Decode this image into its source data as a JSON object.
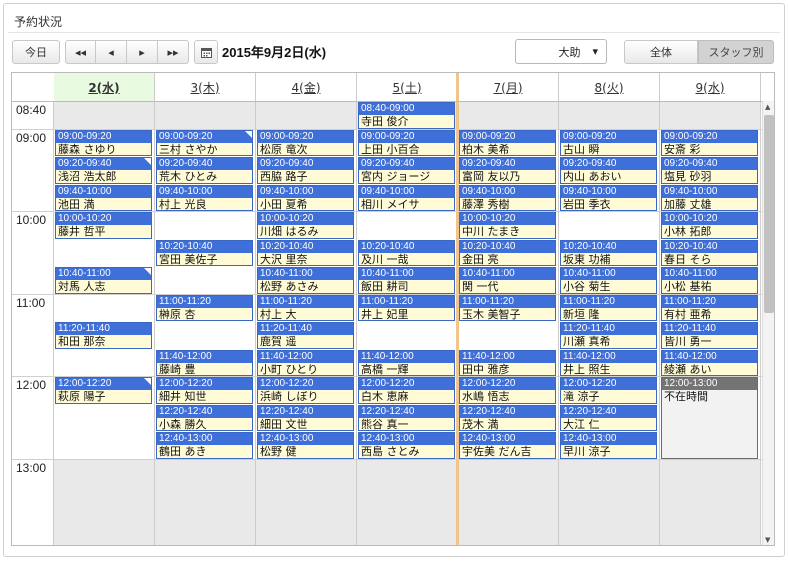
{
  "panel": {
    "title": "予約状況"
  },
  "toolbar": {
    "today_label": "今日",
    "prev_month": "◂◂",
    "prev": "◂",
    "next": "▸",
    "next_month": "▸▸",
    "calendar_icon": "calendar-icon",
    "date_title": "2015年9月2日(水)",
    "facility": {
      "selected": "大助",
      "caret": "▾"
    },
    "view_all": "全体",
    "view_staff": "スタッフ別",
    "active_view": "スタッフ別"
  },
  "colors": {
    "accent": "#3f6fd9",
    "appointment_bg": "#fffbd6",
    "today_bg": "#e8fbe0",
    "today_line": "#f0c48a",
    "blocked": "#747474"
  },
  "times": [
    "08:40",
    "09:00",
    "10:00",
    "11:00",
    "12:00",
    "13:00"
  ],
  "days": [
    {
      "label": "2(水)",
      "today": true,
      "bold": true,
      "appts": [
        {
          "time": "09:00-09:20",
          "name": "藤森 さゆり"
        },
        {
          "time": "09:20-09:40",
          "name": "浅沼 浩太郎",
          "flag": true
        },
        {
          "time": "09:40-10:00",
          "name": "池田 満"
        },
        {
          "time": "10:00-10:20",
          "name": "藤井 哲平"
        },
        {
          "time": "10:40-11:00",
          "name": "対馬 人志",
          "flag": true
        },
        {
          "time": "11:20-11:40",
          "name": "和田 那奈"
        },
        {
          "time": "12:00-12:20",
          "name": "萩原 陽子",
          "flag": true
        }
      ]
    },
    {
      "label": "3(木)",
      "appts": [
        {
          "time": "09:00-09:20",
          "name": "三村 さやか",
          "flag": true
        },
        {
          "time": "09:20-09:40",
          "name": "荒木 ひとみ"
        },
        {
          "time": "09:40-10:00",
          "name": "村上 光良"
        },
        {
          "time": "10:20-10:40",
          "name": "宮田 美佐子"
        },
        {
          "time": "11:00-11:20",
          "name": "榊原 杏"
        },
        {
          "time": "11:40-12:00",
          "name": "藤崎 豊"
        },
        {
          "time": "12:00-12:20",
          "name": "細井 知世"
        },
        {
          "time": "12:20-12:40",
          "name": "小森 勝久"
        },
        {
          "time": "12:40-13:00",
          "name": "鶴田 あき"
        }
      ]
    },
    {
      "label": "4(金)",
      "appts": [
        {
          "time": "09:00-09:20",
          "name": "松原 竜次"
        },
        {
          "time": "09:20-09:40",
          "name": "西脇 路子"
        },
        {
          "time": "09:40-10:00",
          "name": "小田 夏希"
        },
        {
          "time": "10:00-10:20",
          "name": "川畑 はるみ"
        },
        {
          "time": "10:20-10:40",
          "name": "大沢 里奈"
        },
        {
          "time": "10:40-11:00",
          "name": "松野 あさみ"
        },
        {
          "time": "11:00-11:20",
          "name": "村上 大"
        },
        {
          "time": "11:20-11:40",
          "name": "鹿賀 遥"
        },
        {
          "time": "11:40-12:00",
          "name": "小町 ひとり"
        },
        {
          "time": "12:00-12:20",
          "name": "浜崎 しぼり"
        },
        {
          "time": "12:20-12:40",
          "name": "細田 文世"
        },
        {
          "time": "12:40-13:00",
          "name": "松野 健"
        }
      ]
    },
    {
      "label": "5(土)",
      "appts": [
        {
          "time": "08:40-09:00",
          "name": "寺田 俊介"
        },
        {
          "time": "09:00-09:20",
          "name": "上田 小百合"
        },
        {
          "time": "09:20-09:40",
          "name": "宮内 ジョージ"
        },
        {
          "time": "09:40-10:00",
          "name": "相川 メイサ"
        },
        {
          "time": "10:20-10:40",
          "name": "及川 一哉"
        },
        {
          "time": "10:40-11:00",
          "name": "飯田 耕司"
        },
        {
          "time": "11:00-11:20",
          "name": "井上 妃里"
        },
        {
          "time": "11:40-12:00",
          "name": "高橋 一輝"
        },
        {
          "time": "12:00-12:20",
          "name": "白木 恵麻"
        },
        {
          "time": "12:20-12:40",
          "name": "熊谷 真一"
        },
        {
          "time": "12:40-13:00",
          "name": "西島 さとみ"
        }
      ]
    },
    {
      "label": "7(月)",
      "appts": [
        {
          "time": "09:00-09:20",
          "name": "柏木 美希"
        },
        {
          "time": "09:20-09:40",
          "name": "富岡 友以乃"
        },
        {
          "time": "09:40-10:00",
          "name": "藤澤 秀樹"
        },
        {
          "time": "10:00-10:20",
          "name": "中川 たまき"
        },
        {
          "time": "10:20-10:40",
          "name": "金田 亮"
        },
        {
          "time": "10:40-11:00",
          "name": "関 一代"
        },
        {
          "time": "11:00-11:20",
          "name": "玉木 美智子"
        },
        {
          "time": "11:40-12:00",
          "name": "田中 雅彦"
        },
        {
          "time": "12:00-12:20",
          "name": "水嶋 悟志"
        },
        {
          "time": "12:20-12:40",
          "name": "茂木 満"
        },
        {
          "time": "12:40-13:00",
          "name": "宇佐美 だん吉"
        }
      ]
    },
    {
      "label": "8(火)",
      "appts": [
        {
          "time": "09:00-09:20",
          "name": "古山 瞬"
        },
        {
          "time": "09:20-09:40",
          "name": "内山 あおい"
        },
        {
          "time": "09:40-10:00",
          "name": "岩田 季衣"
        },
        {
          "time": "10:20-10:40",
          "name": "坂東 功補"
        },
        {
          "time": "10:40-11:00",
          "name": "小谷 菊生"
        },
        {
          "time": "11:00-11:20",
          "name": "新垣 隆"
        },
        {
          "time": "11:20-11:40",
          "name": "川瀬 真希"
        },
        {
          "time": "11:40-12:00",
          "name": "井上 照生"
        },
        {
          "time": "12:00-12:20",
          "name": "滝 涼子"
        },
        {
          "time": "12:20-12:40",
          "name": "大江 仁"
        },
        {
          "time": "12:40-13:00",
          "name": "早川 涼子"
        }
      ]
    },
    {
      "label": "9(水)",
      "appts": [
        {
          "time": "09:00-09:20",
          "name": "安斎 彩"
        },
        {
          "time": "09:20-09:40",
          "name": "塩見 砂羽"
        },
        {
          "time": "09:40-10:00",
          "name": "加藤 丈雄"
        },
        {
          "time": "10:00-10:20",
          "name": "小林 拓郎"
        },
        {
          "time": "10:20-10:40",
          "name": "春日 そら"
        },
        {
          "time": "10:40-11:00",
          "name": "小松 基祐"
        },
        {
          "time": "11:00-11:20",
          "name": "有村 亜希"
        },
        {
          "time": "11:20-11:40",
          "name": "皆川 勇一"
        },
        {
          "time": "11:40-12:00",
          "name": "綾瀬 あい"
        },
        {
          "time": "12:00-13:00",
          "name": "不在時間",
          "blocked": true
        }
      ]
    }
  ]
}
